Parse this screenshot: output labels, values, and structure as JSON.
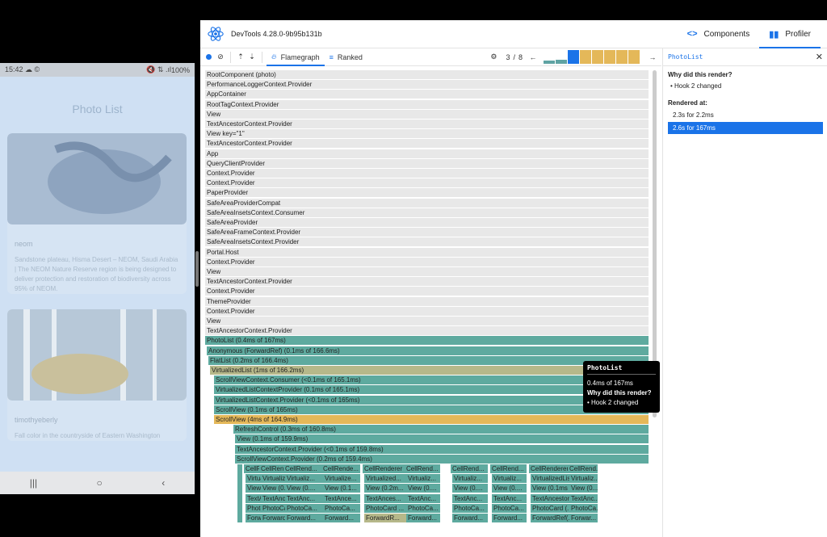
{
  "phone": {
    "status": {
      "time": "15:42",
      "left_icons": "☁ ©",
      "right_icons": "🔇 ⇅ .ıl",
      "battery": "100%"
    },
    "title": "Photo List",
    "cards": [
      {
        "author": "neom",
        "description": "Sandstone plateau, Hisma Desert – NEOM, Saudi Arabia | The NEOM Nature Reserve region is being designed to deliver protection and restoration of biodiversity across 95% of NEOM."
      },
      {
        "author": "timothyeberly",
        "description": "Fall color in the countryside of Eastern Washington"
      }
    ],
    "nav": {
      "recents": "|||",
      "home": "○",
      "back": "‹"
    }
  },
  "devtools": {
    "version": "DevTools 4.28.0-9b95b131b",
    "tabs": {
      "components": "Components",
      "profiler": "Profiler",
      "components_icon": "<>",
      "profiler_icon": "▮▮"
    },
    "toolbar": {
      "flamegraph": "Flamegraph",
      "ranked": "Ranked",
      "commit_index": "3",
      "commit_sep": "/",
      "commit_total": "8",
      "prev": "←",
      "next": "→"
    },
    "flame_rows": [
      "RootComponent (photo)",
      "PerformanceLoggerContext.Provider",
      "AppContainer",
      "RootTagContext.Provider",
      "View",
      "TextAncestorContext.Provider",
      "View key=\"1\"",
      "TextAncestorContext.Provider",
      "App",
      "QueryClientProvider",
      "Context.Provider",
      "Context.Provider",
      "PaperProvider",
      "SafeAreaProviderCompat",
      "SafeAreaInsetsContext.Consumer",
      "SafeAreaProvider",
      "SafeAreaFrameContext.Provider",
      "SafeAreaInsetsContext.Provider",
      "Portal.Host",
      "Context.Provider",
      "View",
      "TextAncestorContext.Provider",
      "Context.Provider",
      "ThemeProvider",
      "Context.Provider",
      "View",
      "TextAncestorContext.Provider"
    ],
    "colored_rows": [
      {
        "label": "PhotoList (0.4ms of 167ms)",
        "color": "teal",
        "indent": 0
      },
      {
        "label": "Anonymous (ForwardRef) (0.1ms of 166.6ms)",
        "color": "teal",
        "indent": 1
      },
      {
        "label": "FlatList (0.2ms of 166.4ms)",
        "color": "teal",
        "indent": 2
      },
      {
        "label": "VirtualizedList (1ms of 166.2ms)",
        "color": "olive",
        "indent": 3
      },
      {
        "label": "ScrollViewContext.Consumer (<0.1ms of 165.1ms)",
        "color": "teal",
        "indent": 4
      },
      {
        "label": "VirtualizedListContextProvider (0.1ms of 165.1ms)",
        "color": "teal",
        "indent": 4
      },
      {
        "label": "VirtualizedListContext.Provider (<0.1ms of 165ms)",
        "color": "teal",
        "indent": 4
      },
      {
        "label": "ScrollView (0.1ms of 165ms)",
        "color": "teal",
        "indent": 4
      },
      {
        "label": "ScrollView (4ms of 164.9ms)",
        "color": "yellow",
        "indent": 4
      },
      {
        "label": "RefreshControl (0.3ms of 160.8ms)",
        "color": "teal",
        "indent": 5
      },
      {
        "label": "View (0.1ms of 159.9ms)",
        "color": "teal",
        "indent": 6
      },
      {
        "label": "TextAncestorContext.Provider (<0.1ms of 159.8ms)",
        "color": "teal",
        "indent": 6
      },
      {
        "label": "ScrollViewContext.Provider (0.2ms of 159.4ms)",
        "color": "teal",
        "indent": 6
      }
    ],
    "cell_columns": [
      [
        "CellRend...",
        "Virtualiz...",
        "View (0....",
        "TextAnc...",
        "PhotoC...",
        "Forward..."
      ],
      [
        "CellRend...",
        "Virtualiz...",
        "View (0....",
        "TextAnc...",
        "PhotoCa...",
        "Forward..."
      ],
      [
        "CellRend...",
        "Virtualiz...",
        "View (0....",
        "TextAnc...",
        "PhotoCa...",
        "Forward..."
      ],
      [
        "CellRende...",
        "Virtualize...",
        "View (0.1...",
        "TextAnce...",
        "PhotoCa...",
        "Forward..."
      ],
      [
        "CellRenderer ...",
        "Virtualized...",
        "View (0.2m...",
        "TextAnces...",
        "PhotoCard ...",
        "ForwardR..."
      ],
      [
        "CellRend...",
        "Virtualiz...",
        "View (0....",
        "TextAnc...",
        "PhotoCa...",
        "Forward..."
      ],
      [
        "CellRend...",
        "Virtualiz...",
        "View (0....",
        "TextAnc...",
        "PhotoCa...",
        "Forward..."
      ],
      [
        "CellRend...",
        "Virtualiz...",
        "View (0....",
        "TextAnc...",
        "PhotoCa...",
        "Forward..."
      ],
      [
        "CellRenderer ...",
        "VirtualizedLis...",
        "View (0.1ms ...",
        "TextAncestor...",
        "PhotoCard (...",
        "ForwardRef(..."
      ],
      [
        "CellRend...",
        "Virtualiz...",
        "View (0....",
        "TextAnc...",
        "PhotoCa...",
        "Forwar..."
      ]
    ],
    "tooltip": {
      "title": "PhotoList",
      "timing": "0.4ms of 167ms",
      "why_label": "Why did this render?",
      "why_value": "• Hook 2 changed"
    },
    "sidebar": {
      "component": "PhotoList",
      "close": "✕",
      "why_label": "Why did this render?",
      "why_value": "• Hook 2 changed",
      "rendered_label": "Rendered at:",
      "commits": [
        "2.3s for 2.2ms",
        "2.6s for 167ms"
      ]
    },
    "colors": {
      "accent": "#1a73e8",
      "teal": "#5eaa9f",
      "yellow": "#e4b859",
      "gray": "#e8e8e8"
    }
  }
}
